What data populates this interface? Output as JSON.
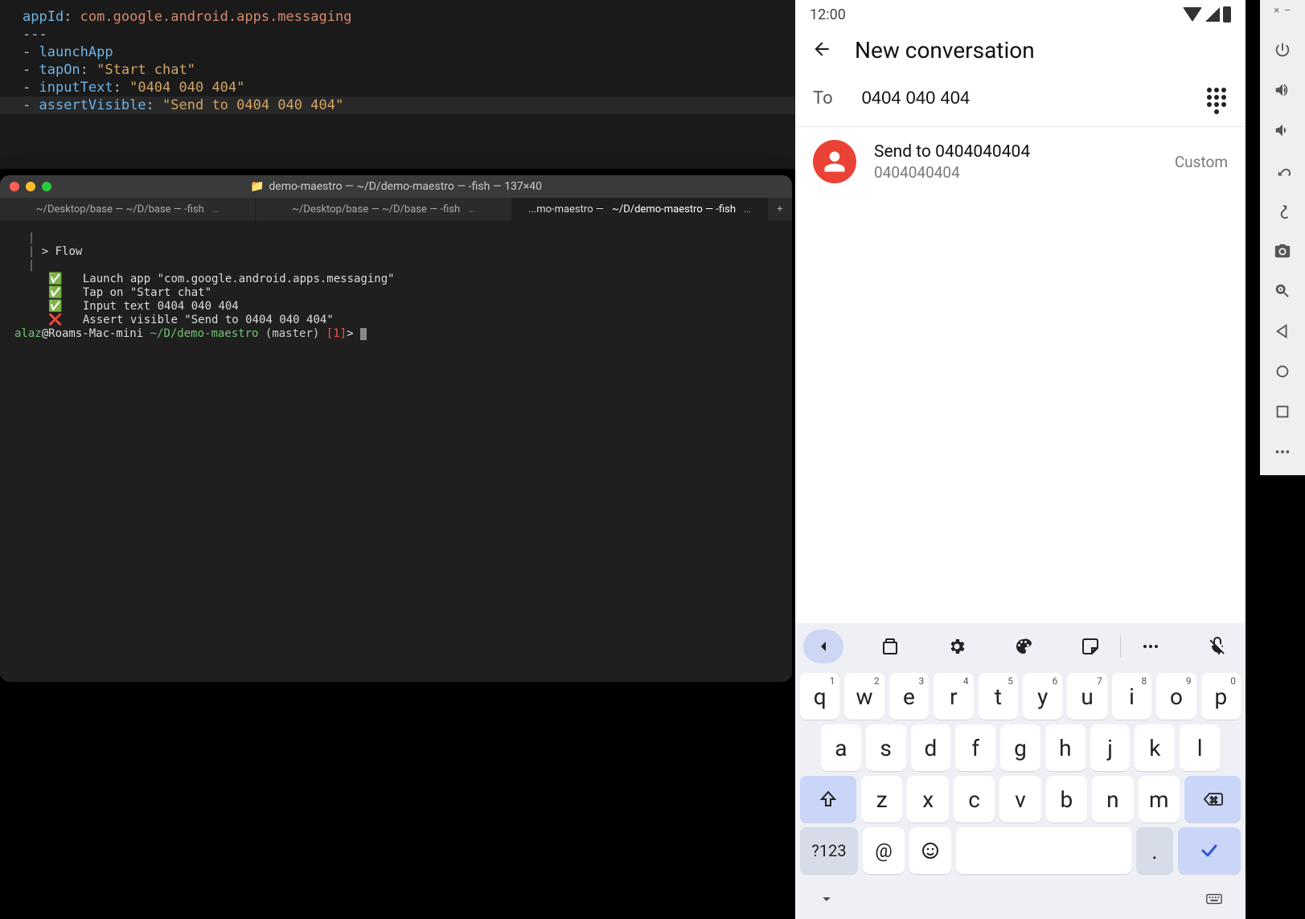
{
  "editor": {
    "lines": [
      {
        "cls": "",
        "html": [
          [
            "key",
            "appId"
          ],
          [
            "pun",
            ": "
          ],
          [
            "cmd",
            "com.google.android.apps.messaging"
          ]
        ]
      },
      {
        "cls": "",
        "html": [
          [
            "pun",
            "---"
          ]
        ]
      },
      {
        "cls": "",
        "html": [
          [
            "pun",
            "- "
          ],
          [
            "key",
            "launchApp"
          ]
        ]
      },
      {
        "cls": "",
        "html": [
          [
            "pun",
            "- "
          ],
          [
            "key",
            "tapOn"
          ],
          [
            "pun",
            ": "
          ],
          [
            "str",
            "\"Start chat\""
          ]
        ]
      },
      {
        "cls": "",
        "html": [
          [
            "pun",
            "- "
          ],
          [
            "key",
            "inputText"
          ],
          [
            "pun",
            ": "
          ],
          [
            "str",
            "\"0404 040 404\""
          ]
        ]
      },
      {
        "cls": "active",
        "html": [
          [
            "pun",
            "- "
          ],
          [
            "key",
            "assertVisible"
          ],
          [
            "pun",
            ": "
          ],
          [
            "str",
            "\"Send to 0404 040 404\""
          ]
        ]
      }
    ]
  },
  "terminal": {
    "title_suffix": "demo-maestro — ~/D/demo-maestro — -fish — 137×40",
    "tabs": [
      {
        "a": "~/Desktop/base — ~/D/base — -fish",
        "active": false
      },
      {
        "a": "~/Desktop/base — ~/D/base — -fish",
        "active": false
      },
      {
        "a": "...mo-maestro —",
        "a2": "~/D/demo-maestro — -fish",
        "active": true
      }
    ],
    "flow_header": "> Flow",
    "steps": [
      {
        "ok": true,
        "text": "Launch app \"com.google.android.apps.messaging\""
      },
      {
        "ok": true,
        "text": "Tap on \"Start chat\""
      },
      {
        "ok": true,
        "text": "Input text 0404 040 404"
      },
      {
        "ok": false,
        "text": "Assert visible \"Send to 0404 040 404\""
      }
    ],
    "prompt": {
      "user": "alaz",
      "host": "@Roams-Mac-mini",
      "path": "~/D/demo-maestro",
      "branch": "(master)",
      "code": "[1]",
      "sep": ">"
    }
  },
  "emulator": {
    "statusbar": {
      "time": "12:00"
    },
    "header": {
      "title": "New conversation"
    },
    "to": {
      "label": "To",
      "value": "0404 040 404"
    },
    "contact": {
      "title": "Send to 0404040404",
      "subtitle": "0404040404",
      "meta": "Custom"
    },
    "keyboard": {
      "row1": [
        {
          "k": "q",
          "s": "1"
        },
        {
          "k": "w",
          "s": "2"
        },
        {
          "k": "e",
          "s": "3"
        },
        {
          "k": "r",
          "s": "4"
        },
        {
          "k": "t",
          "s": "5"
        },
        {
          "k": "y",
          "s": "6"
        },
        {
          "k": "u",
          "s": "7"
        },
        {
          "k": "i",
          "s": "8"
        },
        {
          "k": "o",
          "s": "9"
        },
        {
          "k": "p",
          "s": "0"
        }
      ],
      "row2": [
        "a",
        "s",
        "d",
        "f",
        "g",
        "h",
        "j",
        "k",
        "l"
      ],
      "row3": [
        "z",
        "x",
        "c",
        "v",
        "b",
        "n",
        "m"
      ],
      "symKey": "?123",
      "atKey": "@",
      "dotKey": "."
    }
  },
  "sidebar_tools": [
    "power",
    "volume-up",
    "volume-down",
    "rotate-left",
    "rotate-right",
    "camera",
    "zoom",
    "back",
    "home",
    "overview",
    "more"
  ]
}
